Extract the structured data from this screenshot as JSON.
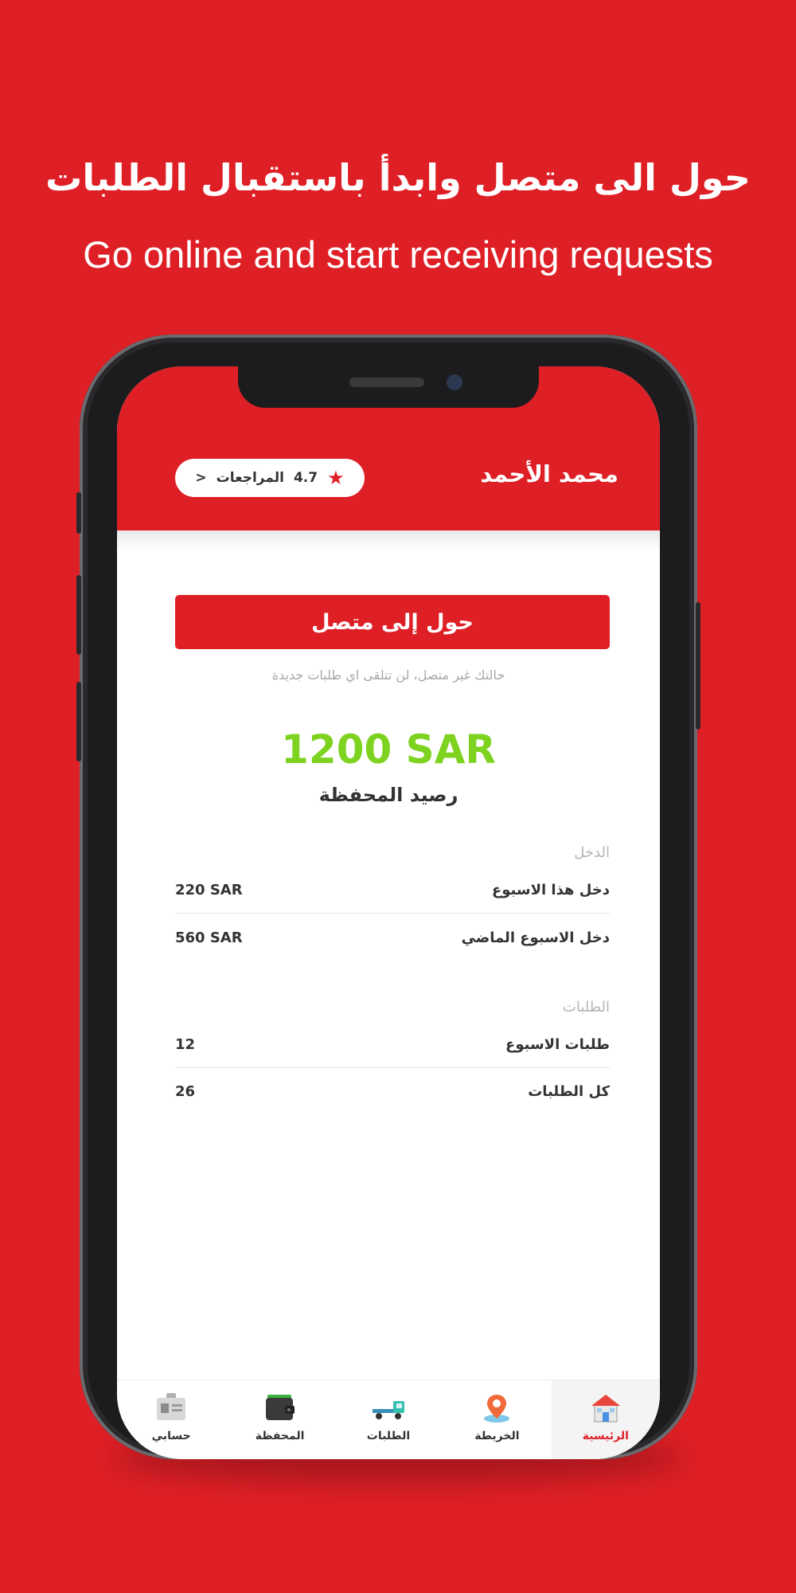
{
  "promo": {
    "arabic_heading": "حول الى متصل وابدأ باستقبال الطلبات",
    "english_heading": "Go online and start receiving requests"
  },
  "header": {
    "name": "محمد الأحمد",
    "rating_value": "4.7",
    "reviews_label": "المراجعات",
    "chevron": "<"
  },
  "online_button": {
    "label": "حول إلى متصل"
  },
  "status_note": "حالتك غير متصل، لن تتلقى اي طلبات جديدة",
  "wallet": {
    "amount": "1200 SAR",
    "label": "رصيد المحفظة"
  },
  "income": {
    "title": "الدخل",
    "rows": [
      {
        "label": "دخل هذا الاسبوع",
        "value": "220 SAR"
      },
      {
        "label": "دخل الاسبوع الماضي",
        "value": "560 SAR"
      }
    ]
  },
  "orders": {
    "title": "الطلبات",
    "rows": [
      {
        "label": "طلبات الاسبوع",
        "value": "12"
      },
      {
        "label": "كل الطلبات",
        "value": "26"
      }
    ]
  },
  "tabs": [
    {
      "label": "الرئيسية",
      "icon": "home-icon",
      "active": true
    },
    {
      "label": "الخريطة",
      "icon": "map-pin-icon",
      "active": false
    },
    {
      "label": "الطلبات",
      "icon": "tow-truck-icon",
      "active": false
    },
    {
      "label": "المحفظة",
      "icon": "wallet-icon",
      "active": false
    },
    {
      "label": "حسابي",
      "icon": "id-card-icon",
      "active": false
    }
  ],
  "colors": {
    "brand_red": "#df1f26",
    "balance_green": "#7ed321",
    "muted_text": "#a8a8a8"
  }
}
